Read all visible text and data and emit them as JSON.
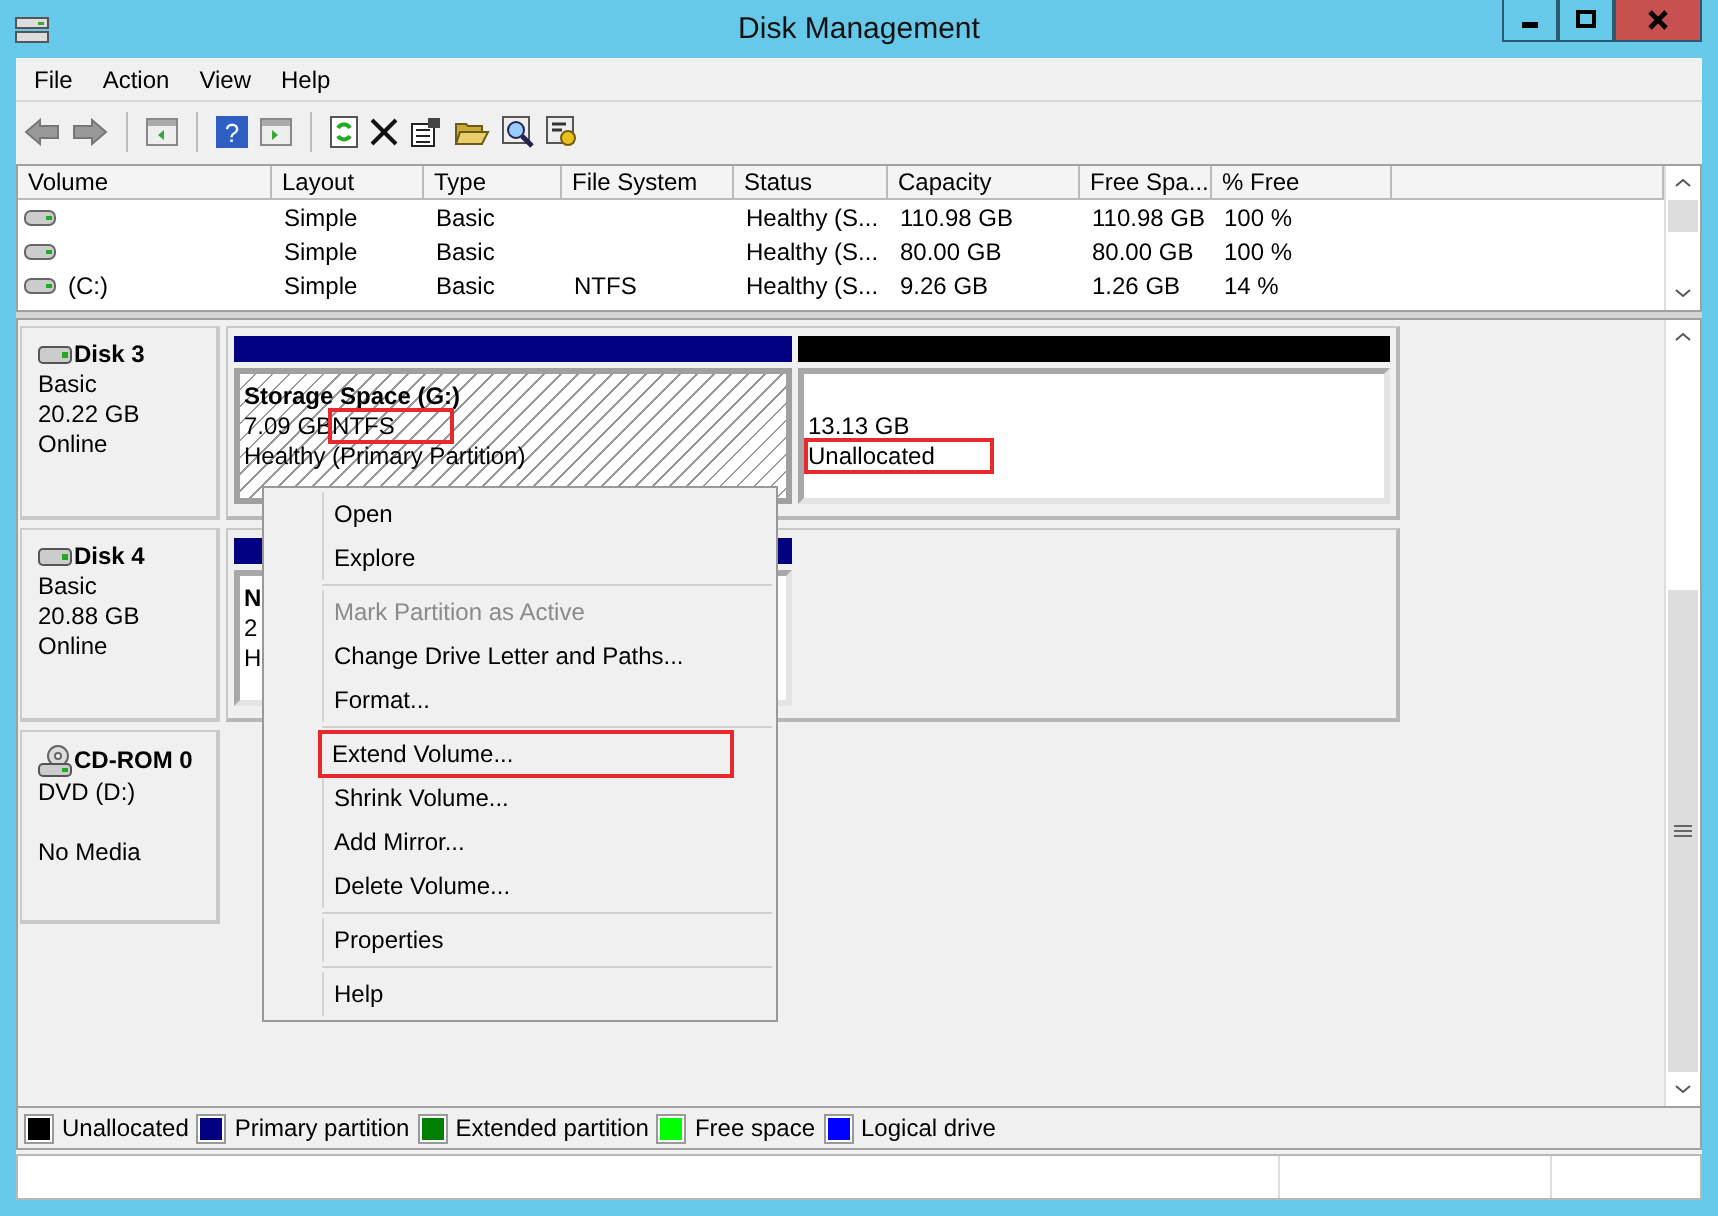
{
  "window": {
    "title": "Disk Management"
  },
  "menu": [
    "File",
    "Action",
    "View",
    "Help"
  ],
  "toolbar": {
    "help_glyph": "?"
  },
  "volume_list": {
    "columns": [
      "Volume",
      "Layout",
      "Type",
      "File System",
      "Status",
      "Capacity",
      "Free Spa...",
      "% Free"
    ],
    "rows": [
      {
        "cells": [
          "",
          "Simple",
          "Basic",
          "",
          "Healthy (S...",
          "110.98 GB",
          "110.98 GB",
          "100 %"
        ]
      },
      {
        "cells": [
          "",
          "Simple",
          "Basic",
          "",
          "Healthy (S...",
          "80.00 GB",
          "80.00 GB",
          "100 %"
        ]
      },
      {
        "cells": [
          "(C:)",
          "Simple",
          "Basic",
          "NTFS",
          "Healthy (S...",
          "9.26 GB",
          "1.26 GB",
          "14 %"
        ]
      }
    ]
  },
  "disks": [
    {
      "kind": "disk",
      "name": "Disk 3",
      "lines": [
        "Basic",
        "20.22 GB",
        "Online"
      ],
      "partitions": [
        {
          "kind": "primary",
          "selected": true,
          "name": "Storage Space  (G:)",
          "size": "7.09 GB",
          "fs": "NTFS",
          "fs_highlighted": true,
          "status": "Healthy (Primary Partition)",
          "status_highlighted": false
        },
        {
          "kind": "unallocated",
          "selected": false,
          "size": "13.13 GB",
          "status": "Unallocated",
          "status_highlighted": true
        }
      ]
    },
    {
      "kind": "disk",
      "name": "Disk 4",
      "lines": [
        "Basic",
        "20.88 GB",
        "Online"
      ],
      "partitions": [
        {
          "kind": "primary",
          "selected": false,
          "name": "N",
          "size": "2",
          "status": "H",
          "status_highlighted": false
        }
      ]
    },
    {
      "kind": "cdrom",
      "name": "CD-ROM 0",
      "lines": [
        "DVD (D:)",
        "No Media"
      ]
    }
  ],
  "context_menu": [
    {
      "kind": "item",
      "label": "Open",
      "disabled": false,
      "highlighted": false
    },
    {
      "kind": "item",
      "label": "Explore",
      "disabled": false,
      "highlighted": false
    },
    {
      "kind": "separator"
    },
    {
      "kind": "item",
      "label": "Mark Partition as Active",
      "disabled": true,
      "highlighted": false
    },
    {
      "kind": "item",
      "label": "Change Drive Letter and Paths...",
      "disabled": false,
      "highlighted": false
    },
    {
      "kind": "item",
      "label": "Format...",
      "disabled": false,
      "highlighted": false
    },
    {
      "kind": "separator"
    },
    {
      "kind": "item",
      "label": "Extend Volume...",
      "disabled": false,
      "highlighted": true
    },
    {
      "kind": "item",
      "label": "Shrink Volume...",
      "disabled": false,
      "highlighted": false
    },
    {
      "kind": "item",
      "label": "Add Mirror...",
      "disabled": false,
      "highlighted": false
    },
    {
      "kind": "item",
      "label": "Delete Volume...",
      "disabled": false,
      "highlighted": false
    },
    {
      "kind": "separator"
    },
    {
      "kind": "item",
      "label": "Properties",
      "disabled": false,
      "highlighted": false
    },
    {
      "kind": "separator"
    },
    {
      "kind": "item",
      "label": "Help",
      "disabled": false,
      "highlighted": false
    }
  ],
  "legend": [
    {
      "label": "Unallocated",
      "color": "#000000"
    },
    {
      "label": "Primary partition",
      "color": "#000080"
    },
    {
      "label": "Extended partition",
      "color": "#008000"
    },
    {
      "label": "Free space",
      "color": "#00ff00"
    },
    {
      "label": "Logical drive",
      "color": "#0000ff"
    }
  ]
}
